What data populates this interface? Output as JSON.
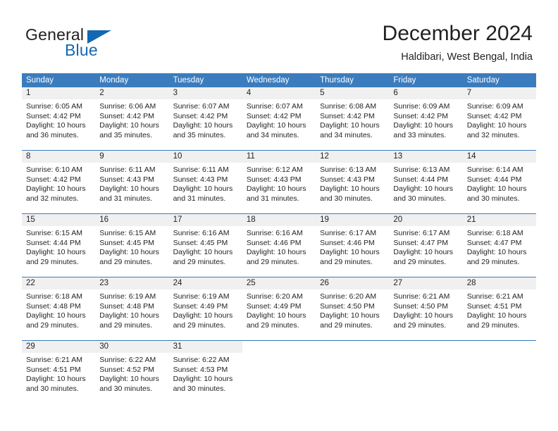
{
  "logo": {
    "word_top": "General",
    "word_bottom": "Blue",
    "accent_color": "#1268b3"
  },
  "header": {
    "month_title": "December 2024",
    "location": "Haldibari, West Bengal, India"
  },
  "theme": {
    "header_blue": "#3b7cbe",
    "daynum_band": "#f0f0f0",
    "text": "#231f20"
  },
  "calendar": {
    "weekdays": [
      "Sunday",
      "Monday",
      "Tuesday",
      "Wednesday",
      "Thursday",
      "Friday",
      "Saturday"
    ],
    "weeks": [
      [
        {
          "day": "1",
          "sunrise": "Sunrise: 6:05 AM",
          "sunset": "Sunset: 4:42 PM",
          "daylight1": "Daylight: 10 hours",
          "daylight2": "and 36 minutes."
        },
        {
          "day": "2",
          "sunrise": "Sunrise: 6:06 AM",
          "sunset": "Sunset: 4:42 PM",
          "daylight1": "Daylight: 10 hours",
          "daylight2": "and 35 minutes."
        },
        {
          "day": "3",
          "sunrise": "Sunrise: 6:07 AM",
          "sunset": "Sunset: 4:42 PM",
          "daylight1": "Daylight: 10 hours",
          "daylight2": "and 35 minutes."
        },
        {
          "day": "4",
          "sunrise": "Sunrise: 6:07 AM",
          "sunset": "Sunset: 4:42 PM",
          "daylight1": "Daylight: 10 hours",
          "daylight2": "and 34 minutes."
        },
        {
          "day": "5",
          "sunrise": "Sunrise: 6:08 AM",
          "sunset": "Sunset: 4:42 PM",
          "daylight1": "Daylight: 10 hours",
          "daylight2": "and 34 minutes."
        },
        {
          "day": "6",
          "sunrise": "Sunrise: 6:09 AM",
          "sunset": "Sunset: 4:42 PM",
          "daylight1": "Daylight: 10 hours",
          "daylight2": "and 33 minutes."
        },
        {
          "day": "7",
          "sunrise": "Sunrise: 6:09 AM",
          "sunset": "Sunset: 4:42 PM",
          "daylight1": "Daylight: 10 hours",
          "daylight2": "and 32 minutes."
        }
      ],
      [
        {
          "day": "8",
          "sunrise": "Sunrise: 6:10 AM",
          "sunset": "Sunset: 4:42 PM",
          "daylight1": "Daylight: 10 hours",
          "daylight2": "and 32 minutes."
        },
        {
          "day": "9",
          "sunrise": "Sunrise: 6:11 AM",
          "sunset": "Sunset: 4:43 PM",
          "daylight1": "Daylight: 10 hours",
          "daylight2": "and 31 minutes."
        },
        {
          "day": "10",
          "sunrise": "Sunrise: 6:11 AM",
          "sunset": "Sunset: 4:43 PM",
          "daylight1": "Daylight: 10 hours",
          "daylight2": "and 31 minutes."
        },
        {
          "day": "11",
          "sunrise": "Sunrise: 6:12 AM",
          "sunset": "Sunset: 4:43 PM",
          "daylight1": "Daylight: 10 hours",
          "daylight2": "and 31 minutes."
        },
        {
          "day": "12",
          "sunrise": "Sunrise: 6:13 AM",
          "sunset": "Sunset: 4:43 PM",
          "daylight1": "Daylight: 10 hours",
          "daylight2": "and 30 minutes."
        },
        {
          "day": "13",
          "sunrise": "Sunrise: 6:13 AM",
          "sunset": "Sunset: 4:44 PM",
          "daylight1": "Daylight: 10 hours",
          "daylight2": "and 30 minutes."
        },
        {
          "day": "14",
          "sunrise": "Sunrise: 6:14 AM",
          "sunset": "Sunset: 4:44 PM",
          "daylight1": "Daylight: 10 hours",
          "daylight2": "and 30 minutes."
        }
      ],
      [
        {
          "day": "15",
          "sunrise": "Sunrise: 6:15 AM",
          "sunset": "Sunset: 4:44 PM",
          "daylight1": "Daylight: 10 hours",
          "daylight2": "and 29 minutes."
        },
        {
          "day": "16",
          "sunrise": "Sunrise: 6:15 AM",
          "sunset": "Sunset: 4:45 PM",
          "daylight1": "Daylight: 10 hours",
          "daylight2": "and 29 minutes."
        },
        {
          "day": "17",
          "sunrise": "Sunrise: 6:16 AM",
          "sunset": "Sunset: 4:45 PM",
          "daylight1": "Daylight: 10 hours",
          "daylight2": "and 29 minutes."
        },
        {
          "day": "18",
          "sunrise": "Sunrise: 6:16 AM",
          "sunset": "Sunset: 4:46 PM",
          "daylight1": "Daylight: 10 hours",
          "daylight2": "and 29 minutes."
        },
        {
          "day": "19",
          "sunrise": "Sunrise: 6:17 AM",
          "sunset": "Sunset: 4:46 PM",
          "daylight1": "Daylight: 10 hours",
          "daylight2": "and 29 minutes."
        },
        {
          "day": "20",
          "sunrise": "Sunrise: 6:17 AM",
          "sunset": "Sunset: 4:47 PM",
          "daylight1": "Daylight: 10 hours",
          "daylight2": "and 29 minutes."
        },
        {
          "day": "21",
          "sunrise": "Sunrise: 6:18 AM",
          "sunset": "Sunset: 4:47 PM",
          "daylight1": "Daylight: 10 hours",
          "daylight2": "and 29 minutes."
        }
      ],
      [
        {
          "day": "22",
          "sunrise": "Sunrise: 6:18 AM",
          "sunset": "Sunset: 4:48 PM",
          "daylight1": "Daylight: 10 hours",
          "daylight2": "and 29 minutes."
        },
        {
          "day": "23",
          "sunrise": "Sunrise: 6:19 AM",
          "sunset": "Sunset: 4:48 PM",
          "daylight1": "Daylight: 10 hours",
          "daylight2": "and 29 minutes."
        },
        {
          "day": "24",
          "sunrise": "Sunrise: 6:19 AM",
          "sunset": "Sunset: 4:49 PM",
          "daylight1": "Daylight: 10 hours",
          "daylight2": "and 29 minutes."
        },
        {
          "day": "25",
          "sunrise": "Sunrise: 6:20 AM",
          "sunset": "Sunset: 4:49 PM",
          "daylight1": "Daylight: 10 hours",
          "daylight2": "and 29 minutes."
        },
        {
          "day": "26",
          "sunrise": "Sunrise: 6:20 AM",
          "sunset": "Sunset: 4:50 PM",
          "daylight1": "Daylight: 10 hours",
          "daylight2": "and 29 minutes."
        },
        {
          "day": "27",
          "sunrise": "Sunrise: 6:21 AM",
          "sunset": "Sunset: 4:50 PM",
          "daylight1": "Daylight: 10 hours",
          "daylight2": "and 29 minutes."
        },
        {
          "day": "28",
          "sunrise": "Sunrise: 6:21 AM",
          "sunset": "Sunset: 4:51 PM",
          "daylight1": "Daylight: 10 hours",
          "daylight2": "and 29 minutes."
        }
      ],
      [
        {
          "day": "29",
          "sunrise": "Sunrise: 6:21 AM",
          "sunset": "Sunset: 4:51 PM",
          "daylight1": "Daylight: 10 hours",
          "daylight2": "and 30 minutes."
        },
        {
          "day": "30",
          "sunrise": "Sunrise: 6:22 AM",
          "sunset": "Sunset: 4:52 PM",
          "daylight1": "Daylight: 10 hours",
          "daylight2": "and 30 minutes."
        },
        {
          "day": "31",
          "sunrise": "Sunrise: 6:22 AM",
          "sunset": "Sunset: 4:53 PM",
          "daylight1": "Daylight: 10 hours",
          "daylight2": "and 30 minutes."
        },
        {
          "day": "",
          "sunrise": "",
          "sunset": "",
          "daylight1": "",
          "daylight2": ""
        },
        {
          "day": "",
          "sunrise": "",
          "sunset": "",
          "daylight1": "",
          "daylight2": ""
        },
        {
          "day": "",
          "sunrise": "",
          "sunset": "",
          "daylight1": "",
          "daylight2": ""
        },
        {
          "day": "",
          "sunrise": "",
          "sunset": "",
          "daylight1": "",
          "daylight2": ""
        }
      ]
    ]
  }
}
